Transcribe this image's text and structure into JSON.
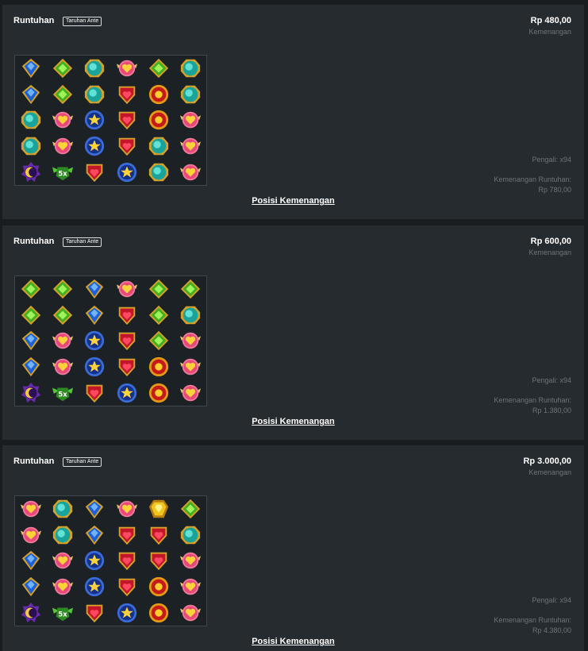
{
  "rounds": [
    {
      "title": "Runtuhan",
      "badge": "Taruhan Ante",
      "amount": "Rp 480,00",
      "amount_label": "Kemenangan",
      "multiplier": "Pengali: x94",
      "tumble_label": "Kemenangan Runtuhan:",
      "tumble_value": "Rp 780,00",
      "link": "Posisi Kemenangan",
      "grid": [
        [
          "blue-gem",
          "green-gem",
          "teal-gem",
          "pink-heart",
          "green-gem",
          "teal-gem"
        ],
        [
          "blue-gem",
          "green-gem",
          "teal-gem",
          "red-heart",
          "sun-gem",
          "teal-gem"
        ],
        [
          "teal-gem",
          "pink-heart",
          "star-gem",
          "red-heart",
          "sun-gem",
          "pink-heart"
        ],
        [
          "teal-gem",
          "pink-heart",
          "star-gem",
          "red-heart",
          "teal-gem",
          "pink-heart"
        ],
        [
          "moon-scatter",
          "multiplier-5x",
          "red-heart",
          "star-gem",
          "teal-gem",
          "pink-heart"
        ]
      ]
    },
    {
      "title": "Runtuhan",
      "badge": "Taruhan Ante",
      "amount": "Rp 600,00",
      "amount_label": "Kemenangan",
      "multiplier": "Pengali: x94",
      "tumble_label": "Kemenangan Runtuhan:",
      "tumble_value": "Rp 1.380,00",
      "link": "Posisi Kemenangan",
      "grid": [
        [
          "green-gem",
          "green-gem",
          "blue-gem",
          "pink-heart",
          "green-gem",
          "green-gem"
        ],
        [
          "green-gem",
          "green-gem",
          "blue-gem",
          "red-heart",
          "green-gem",
          "teal-gem"
        ],
        [
          "blue-gem",
          "pink-heart",
          "star-gem",
          "red-heart",
          "green-gem",
          "pink-heart"
        ],
        [
          "blue-gem",
          "pink-heart",
          "star-gem",
          "red-heart",
          "sun-gem",
          "pink-heart"
        ],
        [
          "moon-scatter",
          "multiplier-5x",
          "red-heart",
          "star-gem",
          "sun-gem",
          "pink-heart"
        ]
      ]
    },
    {
      "title": "Runtuhan",
      "badge": "Taruhan Ante",
      "amount": "Rp 3.000,00",
      "amount_label": "Kemenangan",
      "multiplier": "Pengali: x94",
      "tumble_label": "Kemenangan Runtuhan:",
      "tumble_value": "Rp 4.380,00",
      "link": "Posisi Kemenangan",
      "grid": [
        [
          "pink-heart",
          "teal-gem",
          "blue-gem",
          "pink-heart",
          "yellow-gem",
          "green-gem"
        ],
        [
          "pink-heart",
          "teal-gem",
          "blue-gem",
          "red-heart",
          "red-heart",
          "teal-gem"
        ],
        [
          "blue-gem",
          "pink-heart",
          "star-gem",
          "red-heart",
          "red-heart",
          "pink-heart"
        ],
        [
          "blue-gem",
          "pink-heart",
          "star-gem",
          "red-heart",
          "sun-gem",
          "pink-heart"
        ],
        [
          "moon-scatter",
          "multiplier-5x",
          "red-heart",
          "star-gem",
          "sun-gem",
          "pink-heart"
        ]
      ]
    }
  ],
  "symbol_label": {
    "multiplier-5x": "5x"
  },
  "colors": {
    "page_bg": "#1a1d20",
    "card_bg": "#252b2f",
    "muted_text": "#6c757b",
    "grid_bg": "#1c2125"
  }
}
